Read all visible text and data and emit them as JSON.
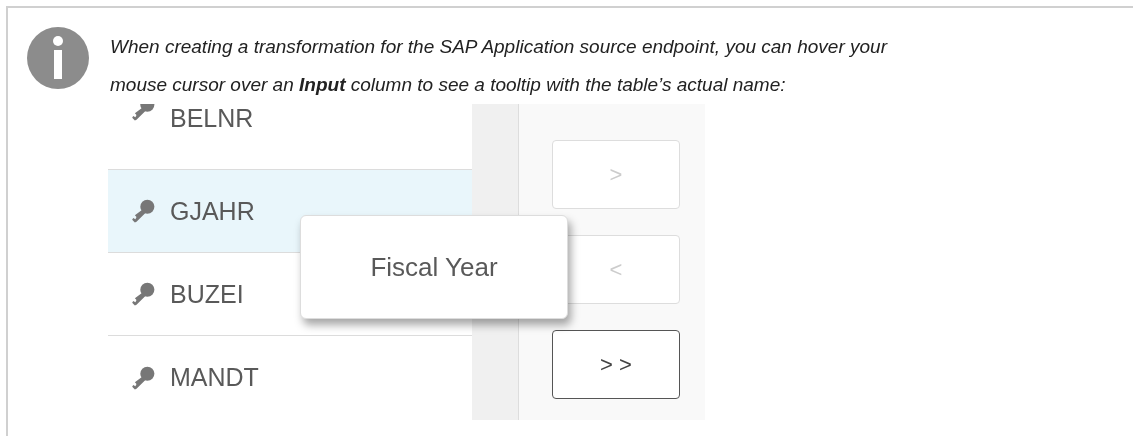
{
  "note": {
    "text": "When creating a transformation for the SAP Application source endpoint, you can hover your mouse cursor over an **Input** column to see a tooltip with the table’s actual name:"
  },
  "example": {
    "rows": [
      {
        "name": "BELNR",
        "selected": false
      },
      {
        "name": "GJAHR",
        "selected": true
      },
      {
        "name": "BUZEI",
        "selected": false
      },
      {
        "name": "MANDT",
        "selected": false
      }
    ],
    "buttons": [
      {
        "label": ">",
        "disabled": true
      },
      {
        "label": "<",
        "disabled": true
      },
      {
        "label": "> >",
        "disabled": false
      }
    ],
    "tooltip": "Fiscal Year"
  }
}
